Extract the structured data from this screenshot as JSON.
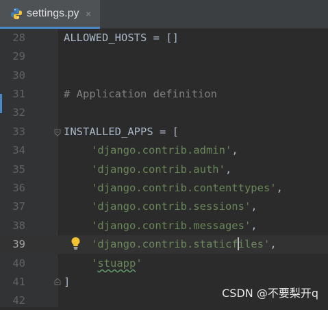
{
  "tab": {
    "filename": "settings.py",
    "file_icon": "python-file-icon",
    "close_icon": "close-icon",
    "close_glyph": "×"
  },
  "editor": {
    "current_line": "39",
    "lines": [
      {
        "number": "28",
        "text": "ALLOWED_HOSTS = []"
      },
      {
        "number": "29",
        "text": ""
      },
      {
        "number": "30",
        "text": ""
      },
      {
        "number": "31",
        "text": "# Application definition"
      },
      {
        "number": "32",
        "text": ""
      },
      {
        "number": "33",
        "text": "INSTALLED_APPS = ["
      },
      {
        "number": "34",
        "text": "'django.contrib.admin',"
      },
      {
        "number": "35",
        "text": "'django.contrib.auth',"
      },
      {
        "number": "36",
        "text": "'django.contrib.contenttypes',"
      },
      {
        "number": "37",
        "text": "'django.contrib.sessions',"
      },
      {
        "number": "38",
        "text": "'django.contrib.messages',"
      },
      {
        "number": "39",
        "text": "'django.contrib.staticfiles',"
      },
      {
        "number": "40",
        "text": "'stuapp'"
      },
      {
        "number": "41",
        "text": "]"
      },
      {
        "number": "42",
        "text": ""
      }
    ],
    "tokens": {
      "l28": "ALLOWED_HOSTS = []",
      "l31": "# Application definition",
      "l33": "INSTALLED_APPS = [",
      "l34s": "'django.contrib.admin'",
      "l34p": ",",
      "l35s": "'django.contrib.auth'",
      "l35p": ",",
      "l36s": "'django.contrib.contenttypes'",
      "l36p": ",",
      "l37s": "'django.contrib.sessions'",
      "l37p": ",",
      "l38s": "'django.contrib.messages'",
      "l38p": ",",
      "l39a": "'django.contrib.staticf",
      "l39b": "iles'",
      "l39p": ",",
      "l40q1": "'",
      "l40w": "stuapp",
      "l40q2": "'",
      "l41": "]"
    },
    "icons": [
      "fold-icon",
      "intention-bulb-icon"
    ]
  },
  "colors": {
    "background": "#2b2b2b",
    "gutter": "#313335",
    "keyword_text": "#a9b7c6",
    "string": "#6a8759",
    "comment": "#808080",
    "line_number": "#606366",
    "current_line": "#323232",
    "tab_accent": "#4a88c7"
  },
  "watermark": "CSDN @不要梨开q"
}
